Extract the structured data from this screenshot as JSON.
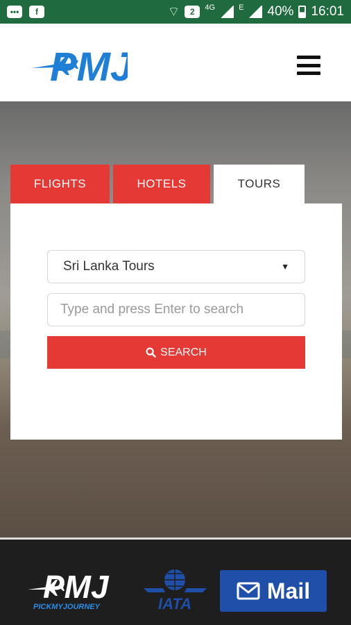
{
  "status_bar": {
    "network_small": "4G",
    "network_small2": "E",
    "battery": "40%",
    "time": "16:01",
    "sim_badge": "2"
  },
  "header": {
    "logo_text": "PMJ"
  },
  "tabs": [
    {
      "label": "FLIGHTS",
      "active": false
    },
    {
      "label": "HOTELS",
      "active": false
    },
    {
      "label": "TOURS",
      "active": true
    }
  ],
  "search": {
    "selected_tour": "Sri Lanka Tours",
    "placeholder": "Type and press Enter to search",
    "button_label": "SEARCH"
  },
  "footer": {
    "logo_text": "PMJ",
    "tagline": "PICKMYJOURNEY",
    "iata_text": "IATA",
    "mail_label": "Mail"
  },
  "colors": {
    "accent_red": "#e53935",
    "brand_blue": "#1f7fd6",
    "status_green": "#1f6b3f",
    "mail_blue": "#1f4fa8"
  }
}
